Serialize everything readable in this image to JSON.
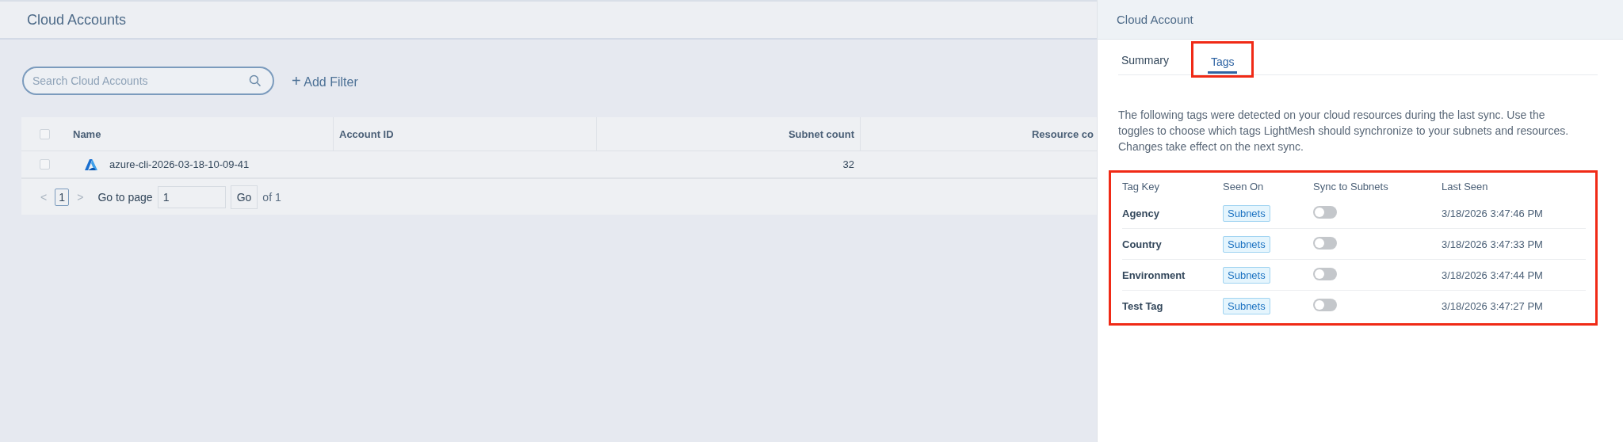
{
  "page": {
    "title": "Cloud Accounts"
  },
  "search": {
    "placeholder": "Search Cloud Accounts"
  },
  "add_filter": {
    "icon": "+",
    "label": "Add Filter"
  },
  "table": {
    "select_all_checked": false,
    "columns": [
      {
        "label": "Name",
        "kind": "text"
      },
      {
        "label": "Account ID",
        "kind": "text"
      },
      {
        "label": "Subnet count",
        "kind": "number"
      },
      {
        "label": "Resource co",
        "kind": "number"
      }
    ],
    "rows": [
      {
        "checked": false,
        "kind": "azure",
        "cells": [
          "azure-cli-2026-03-18-10-09-41",
          "",
          "32",
          ""
        ]
      }
    ]
  },
  "pagination": {
    "prev": "<",
    "current": "1",
    "next": ">",
    "goto_label": "Go to page",
    "goto_value": "1",
    "go": "Go",
    "of": "of 1"
  },
  "panel": {
    "title": "Cloud Account",
    "tabs": [
      {
        "label": "Summary",
        "selected": false,
        "highlighted": false
      },
      {
        "label": "Tags",
        "selected": true,
        "highlighted": true
      }
    ],
    "description": "The following tags were detected on your cloud resources during the last sync. Use the toggles to choose which tags LightMesh should synchronize to your subnets and resources. Changes take effect on the next sync.",
    "tags": {
      "highlighted": true,
      "columns": [
        "Tag Key",
        "Seen On",
        "Sync to Subnets",
        "Last Seen"
      ],
      "rows": [
        {
          "key": "Agency",
          "seen_on": "Subnets",
          "sync": false,
          "last_seen": "3/18/2026 3:47:46 PM"
        },
        {
          "key": "Country",
          "seen_on": "Subnets",
          "sync": false,
          "last_seen": "3/18/2026 3:47:33 PM"
        },
        {
          "key": "Environment",
          "seen_on": "Subnets",
          "sync": false,
          "last_seen": "3/18/2026 3:47:44 PM"
        },
        {
          "key": "Test Tag",
          "seen_on": "Subnets",
          "sync": false,
          "last_seen": "3/18/2026 3:47:27 PM"
        }
      ]
    }
  }
}
